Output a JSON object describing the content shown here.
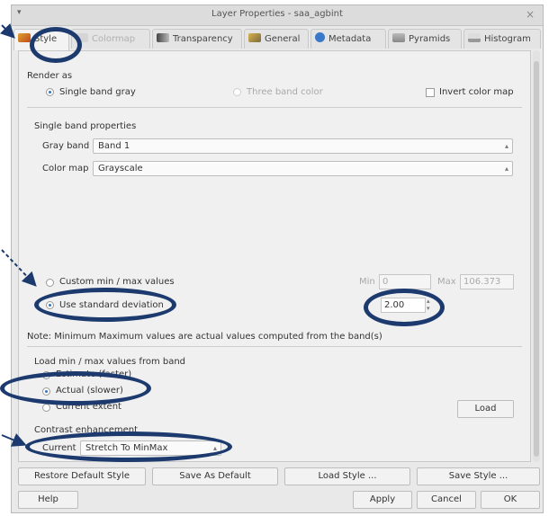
{
  "window": {
    "title": "Layer Properties - saa_agbint",
    "menu_arrow": "▾",
    "close": "×"
  },
  "tabs": [
    {
      "label": "Style",
      "icon": "style-brush-icon",
      "active": true
    },
    {
      "label": "Colormap",
      "icon": "colormap-icon",
      "disabled": true
    },
    {
      "label": "Transparency",
      "icon": "transparency-icon"
    },
    {
      "label": "General",
      "icon": "tools-icon"
    },
    {
      "label": "Metadata",
      "icon": "info-icon"
    },
    {
      "label": "Pyramids",
      "icon": "pyramids-icon"
    },
    {
      "label": "Histogram",
      "icon": "histogram-icon"
    }
  ],
  "render_as": {
    "heading": "Render as",
    "single_band_gray": "Single band gray",
    "three_band_color": "Three band color",
    "invert_color_map": "Invert color map",
    "selected": "single_band_gray"
  },
  "single_band": {
    "heading": "Single band properties",
    "gray_band_label": "Gray band",
    "gray_band_value": "Band 1",
    "color_map_label": "Color map",
    "color_map_value": "Grayscale"
  },
  "minmax": {
    "custom_label": "Custom min / max values",
    "min_label": "Min",
    "min_value": "0",
    "max_label": "Max",
    "max_value": "106.373",
    "std_dev_label": "Use standard deviation",
    "std_dev_value": "2.00",
    "selected": "use_standard_deviation",
    "note": "Note: Minimum Maximum values are actual values computed from the band(s)"
  },
  "load_minmax": {
    "heading": "Load min / max values from band",
    "estimate": "Estimate (faster)",
    "actual": "Actual (slower)",
    "current_extent": "Current extent",
    "selected": "actual",
    "load_button": "Load"
  },
  "contrast": {
    "heading": "Contrast enhancement",
    "current_label": "Current",
    "current_value": "Stretch To MinMax"
  },
  "style_buttons": {
    "restore_default": "Restore Default Style",
    "save_as_default": "Save As Default",
    "load_style": "Load Style ...",
    "save_style": "Save Style ..."
  },
  "dialog_buttons": {
    "help": "Help",
    "apply": "Apply",
    "cancel": "Cancel",
    "ok": "OK"
  },
  "colors": {
    "annotation": "#1c3a6e",
    "radio_selected": "#3b72b8"
  }
}
